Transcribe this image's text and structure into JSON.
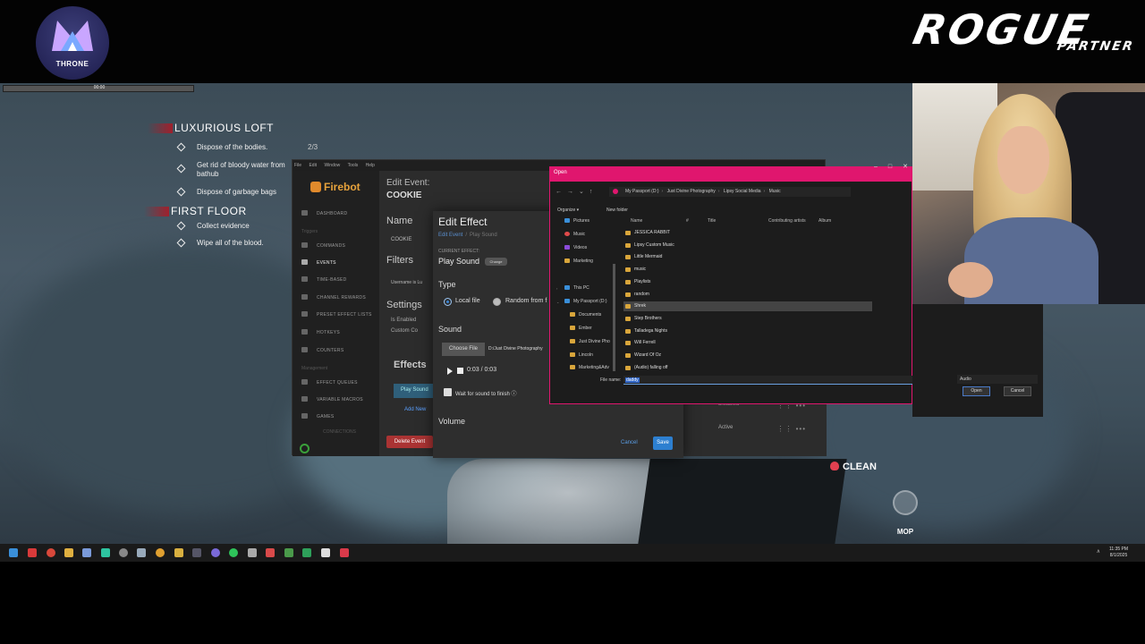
{
  "overlay": {
    "throne_label": "THRONE",
    "rogue_label": "ROGUE",
    "partner_label": "PARTNER"
  },
  "game": {
    "mini_bar_text": "00:00",
    "objectives": [
      {
        "title": "LUXURIOUS LOFT",
        "items": [
          {
            "text": "Dispose of the bodies.",
            "count": "2/3"
          },
          {
            "text": "Get rid of bloody water from bathub",
            "count": ""
          },
          {
            "text": "Dispose of garbage bags",
            "count": ""
          }
        ]
      },
      {
        "title": "FIRST FLOOR",
        "items": [
          {
            "text": "Collect evidence",
            "count": ""
          },
          {
            "text": "Wipe all of the blood.",
            "count": ""
          }
        ]
      }
    ],
    "clean_label": "CLEAN",
    "mop_label": "MOP"
  },
  "firebot": {
    "menu": [
      "File",
      "Edit",
      "Window",
      "Tools",
      "Help"
    ],
    "logo": "Firebot",
    "nav": [
      {
        "label": "DASHBOARD",
        "icon": "dashboard-icon"
      },
      {
        "label": "COMMANDS",
        "icon": "commands-icon"
      },
      {
        "label": "EVENTS",
        "icon": "events-icon"
      },
      {
        "label": "TIME-BASED",
        "icon": "clock-icon"
      },
      {
        "label": "CHANNEL REWARDS",
        "icon": "rewards-icon"
      },
      {
        "label": "PRESET EFFECT LISTS",
        "icon": "list-icon"
      },
      {
        "label": "HOTKEYS",
        "icon": "keyboard-icon"
      },
      {
        "label": "COUNTERS",
        "icon": "counter-icon"
      },
      {
        "label": "EFFECT QUEUES",
        "icon": "queue-icon"
      },
      {
        "label": "VARIABLE MACROS",
        "icon": "macro-icon"
      },
      {
        "label": "GAMES",
        "icon": "games-icon"
      }
    ],
    "categories": [
      "Triggers",
      "Management",
      "CONNECTIONS"
    ],
    "edit_event_label": "Edit Event:",
    "event_name": "COOKIE",
    "name_heading": "Name",
    "name_value": "COOKIE",
    "filters_heading": "Filters",
    "username_filter": "Username is Lu",
    "settings_heading": "Settings",
    "is_enabled": "Is Enabled",
    "custom_cooldown": "Custom Co",
    "effects_heading": "Effects",
    "play_sound_chip": "Play Sound",
    "add_new": "Add New",
    "delete_event": "Delete Event",
    "row_disabled": "Disabled",
    "row_active": "Active"
  },
  "edit_effect": {
    "title": "Edit Effect",
    "breadcrumb_event": "Edit Event",
    "breadcrumb_current": "Play Sound",
    "current_effect_label": "CURRENT EFFECT:",
    "current_effect": "Play Sound",
    "change_button": "Change",
    "type_heading": "Type",
    "local_file": "Local file",
    "random_from": "Random from f",
    "sound_heading": "Sound",
    "choose_file": "Choose File",
    "file_path": "D:/Just Divine Photography",
    "time": "0:03 / 0:03",
    "wait_label": "Wait for sound to finish",
    "volume_heading": "Volume",
    "cancel": "Cancel",
    "save": "Save"
  },
  "open_dialog": {
    "title": "Open",
    "address": [
      "My Passport (D:)",
      "Just Divine Photography",
      "Lipsy Social Media",
      "Music"
    ],
    "organize": "Organize",
    "new_folder": "New folder",
    "tree": [
      {
        "label": "Pictures",
        "icon": "pic"
      },
      {
        "label": "Music",
        "icon": "music"
      },
      {
        "label": "Videos",
        "icon": "video"
      },
      {
        "label": "Marketing",
        "icon": "folder"
      },
      {
        "label": "This PC",
        "icon": "pc"
      },
      {
        "label": "My Passport (D:)",
        "icon": "pc"
      },
      {
        "label": "Documents",
        "icon": "folder"
      },
      {
        "label": "Ember",
        "icon": "folder"
      },
      {
        "label": "Just Divine Pho",
        "icon": "folder"
      },
      {
        "label": "Lincoln",
        "icon": "folder"
      },
      {
        "label": "Marketing&Adv",
        "icon": "folder"
      }
    ],
    "headers": [
      "Name",
      "#",
      "Title",
      "Contributing artists",
      "Album"
    ],
    "files": [
      "JESSICA RABBIT",
      "Lipsy Custom Music",
      "Little Mermaid",
      "music",
      "Playlists",
      "random",
      "Shrek",
      "Step Brothers",
      "Talladega Nights",
      "Will Ferrell",
      "Wizard Of Oz",
      "(Audio) falling off"
    ],
    "selected_index": 6,
    "file_name_label": "File name:",
    "file_name_value": "daddy",
    "filter_value": "Audio",
    "open_button": "Open",
    "cancel_button": "Cancel"
  },
  "taskbar": {
    "time": "11:35 PM",
    "date": "8/1/2025",
    "tray": "∧"
  }
}
